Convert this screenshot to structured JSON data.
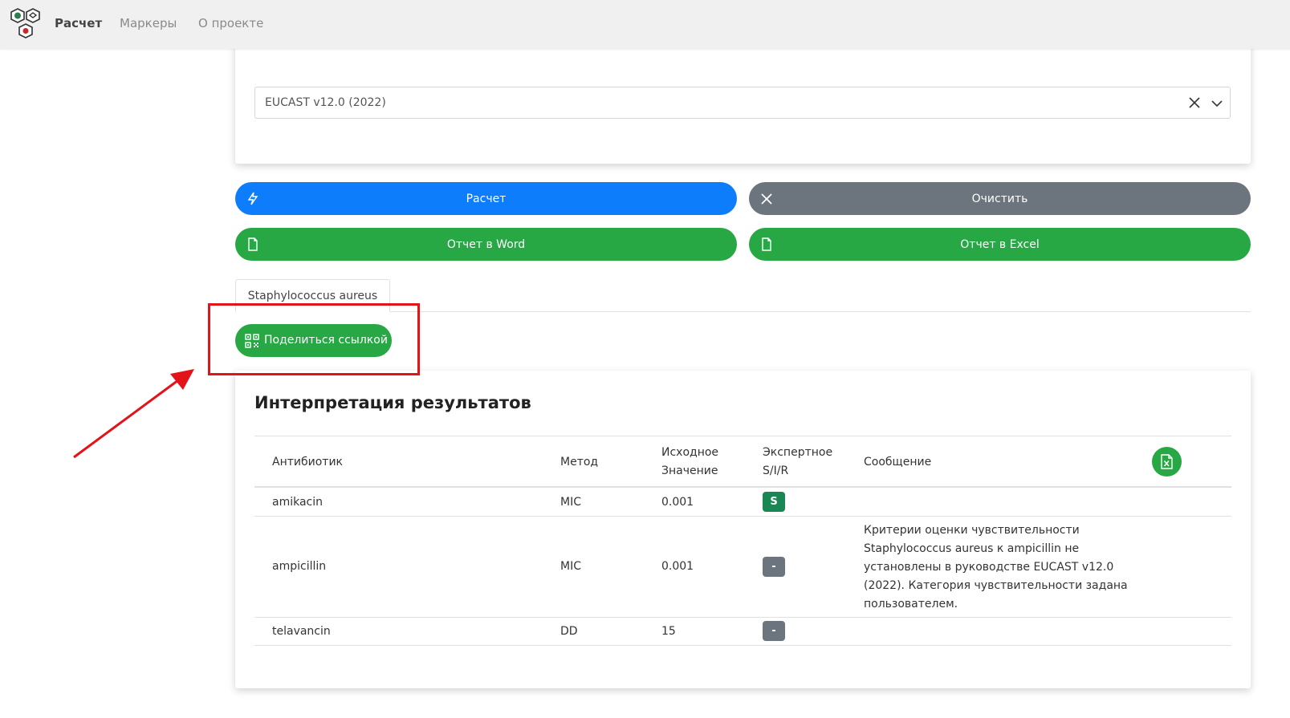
{
  "nav": {
    "links": [
      "Расчет",
      "Маркеры",
      "О проекте"
    ]
  },
  "guideline_select": {
    "value": "EUCAST v12.0 (2022)"
  },
  "actions": {
    "calculate": "Расчет",
    "clear": "Очистить",
    "word_report": "Отчет в Word",
    "excel_report": "Отчет в Excel"
  },
  "tabs": {
    "active": "Staphylococcus aureus"
  },
  "share": {
    "label": "Поделиться ссылкой"
  },
  "results": {
    "title": "Интерпретация результатов",
    "columns": {
      "antibiotic": "Антибиотик",
      "method": "Метод",
      "initial_1": "Исходное",
      "initial_2": "Значение",
      "expert_1": "Экспертное",
      "expert_2": "S/I/R",
      "message": "Сообщение"
    },
    "rows": [
      {
        "antibiotic": "amikacin",
        "method": "MIC",
        "value": "0.001",
        "sir": "S",
        "message": ""
      },
      {
        "antibiotic": "ampicillin",
        "method": "MIC",
        "value": "0.001",
        "sir": "-",
        "message": "Критерии оценки чувствительности Staphylococcus aureus к ampicillin не установлены в руководстве EUCAST v12.0 (2022). Категория чувствительности задана пользователем."
      },
      {
        "antibiotic": "telavancin",
        "method": "DD",
        "value": "15",
        "sir": "-",
        "message": ""
      }
    ]
  },
  "colors": {
    "primary": "#0d7dfc",
    "secondary": "#6c757d",
    "success": "#28a745",
    "badge_s": "#198754",
    "annotation": "#e3131a"
  }
}
